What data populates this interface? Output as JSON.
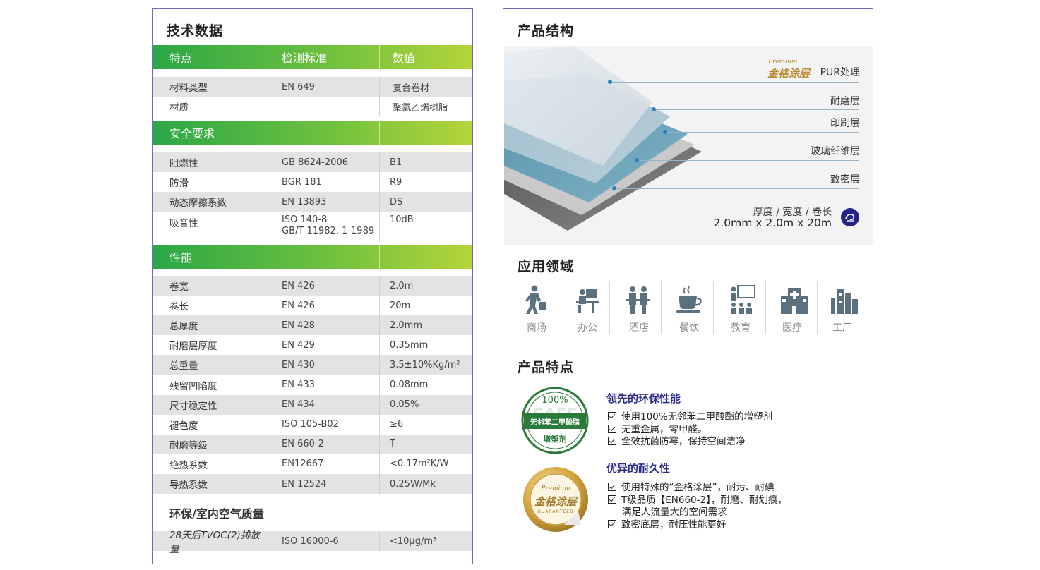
{
  "left": {
    "title": "技术数据",
    "header": {
      "col1": "特点",
      "col2": "检测标准",
      "col3": "数值"
    },
    "material_rows": [
      {
        "name": "材料类型",
        "standard": "EN 649",
        "value": "复合卷材"
      },
      {
        "name": "材质",
        "standard": "",
        "value": "聚氯乙烯树脂"
      }
    ],
    "safety_header": "安全要求",
    "safety_rows": [
      {
        "name": "阻燃性",
        "standard": "GB 8624-2006",
        "value": "B1"
      },
      {
        "name": "防滑",
        "standard": "BGR 181",
        "value": "R9"
      },
      {
        "name": "动态摩擦系数",
        "standard": "EN 13893",
        "value": "DS"
      },
      {
        "name": "吸音性",
        "standard_line1": "ISO 140-8",
        "standard_line2": "GB/T 11982. 1-1989",
        "value": "10dB"
      }
    ],
    "performance_header": "性能",
    "performance_rows": [
      {
        "name": "卷宽",
        "standard": "EN 426",
        "value": "2.0m"
      },
      {
        "name": "卷长",
        "standard": "EN 426",
        "value": "20m"
      },
      {
        "name": "总厚度",
        "standard": "EN 428",
        "value": "2.0mm"
      },
      {
        "name": "耐磨层厚度",
        "standard": "EN 429",
        "value": "0.35mm"
      },
      {
        "name": "总重量",
        "standard": "EN 430",
        "value": "3.5±10%Kg/m²"
      },
      {
        "name": "残留凹陷度",
        "standard": "EN 433",
        "value": "0.08mm"
      },
      {
        "name": "尺寸稳定性",
        "standard": "EN 434",
        "value": "0.05%"
      },
      {
        "name": "褪色度",
        "standard": "ISO 105-B02",
        "value": "≥6"
      },
      {
        "name": "耐磨等级",
        "standard": "EN 660-2",
        "value": "T"
      },
      {
        "name": "绝热系数",
        "standard": "EN12667",
        "value": "<0.17m²K/W"
      },
      {
        "name": "导热系数",
        "standard": "EN 12524",
        "value": "0.25W/Mk"
      }
    ],
    "env_header": "环保/室内空气质量",
    "env_rows": [
      {
        "name": "28天后TVOC(2)排放量",
        "standard": "ISO 16000-6",
        "value": "<10μg/m³"
      }
    ]
  },
  "right": {
    "structure_title": "产品结构",
    "brand_premium": "Premium",
    "brand_logo": "金格涂层",
    "layers": [
      "PUR处理",
      "耐磨层",
      "印刷层",
      "玻璃纤维层",
      "致密层"
    ],
    "dims_label": "厚度 / 宽度 / 卷长",
    "dims_value": "2.0mm x 2.0m x 20m",
    "application_title": "应用领域",
    "applications": [
      {
        "label": "商场",
        "icon": "shopper-icon"
      },
      {
        "label": "办公",
        "icon": "office-desk-icon"
      },
      {
        "label": "酒店",
        "icon": "hotel-staff-icon"
      },
      {
        "label": "餐饮",
        "icon": "coffee-cup-icon"
      },
      {
        "label": "教育",
        "icon": "classroom-icon"
      },
      {
        "label": "医疗",
        "icon": "hospital-icon"
      },
      {
        "label": "工厂",
        "icon": "factory-icon"
      }
    ],
    "features_title": "产品特点",
    "badge_safe": {
      "percent": "100%",
      "ribbon": "无邻苯二甲酸脂",
      "bottom": "增塑剂",
      "watermark": "SAFE"
    },
    "feature1": {
      "title": "领先的环保性能",
      "items": [
        "使用100%无邻苯二甲酸酯的增塑剂",
        "无重金属，零甲醛。",
        "全效抗菌防霉，保持空间洁净"
      ]
    },
    "badge_gold": {
      "premium": "Premium",
      "logo": "金格涂层",
      "guarantee": "GUARANTEED"
    },
    "feature2": {
      "title": "优异的耐久性",
      "items": [
        "使用特殊的“金格涂层”，耐污、耐碘",
        "T级品质【EN660-2】，耐磨、耐划痕，",
        "满足人流量大的空间需求",
        "致密底层，耐压性能更好"
      ]
    },
    "colors": {
      "border": "#6e6abf",
      "green_start": "#2aa746",
      "green_end": "#b5d43a",
      "feature_title": "#2a2a8c",
      "gold": "#b8892e",
      "safe_green": "#2a7a3c"
    }
  }
}
